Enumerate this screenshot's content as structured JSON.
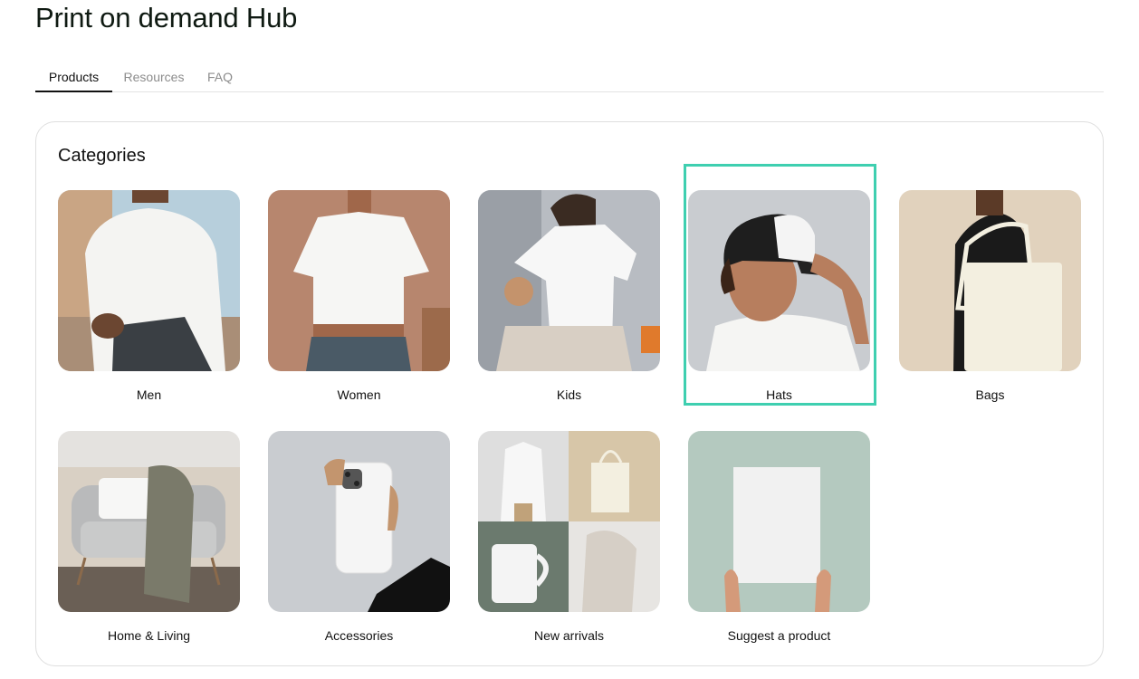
{
  "header": {
    "title": "Print on demand Hub"
  },
  "tabs": [
    {
      "label": "Products",
      "active": true
    },
    {
      "label": "Resources",
      "active": false
    },
    {
      "label": "FAQ",
      "active": false
    }
  ],
  "categories": {
    "heading": "Categories",
    "items": [
      {
        "label": "Men"
      },
      {
        "label": "Women"
      },
      {
        "label": "Kids"
      },
      {
        "label": "Hats",
        "highlighted": true
      },
      {
        "label": "Bags"
      },
      {
        "label": "Home & Living"
      },
      {
        "label": "Accessories"
      },
      {
        "label": "New arrivals"
      },
      {
        "label": "Suggest a product"
      }
    ]
  },
  "colors": {
    "highlight": "#3fcfb0",
    "active_tab": "#111111",
    "inactive_tab": "#8c8c8c"
  }
}
